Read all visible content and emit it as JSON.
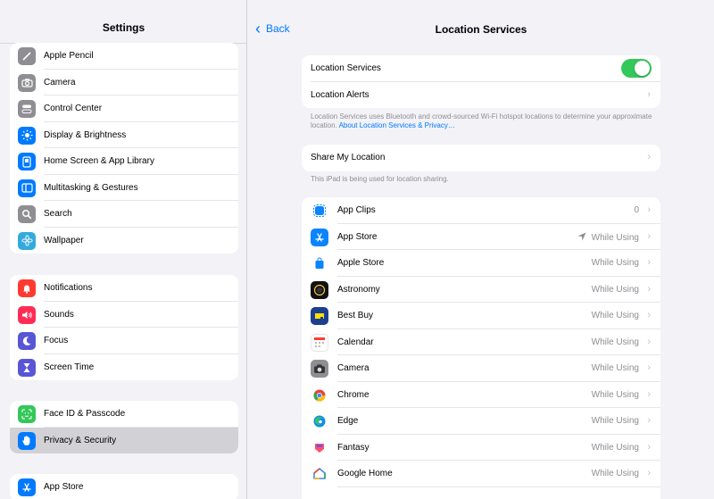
{
  "sidebar": {
    "title": "Settings",
    "group1": [
      {
        "label": "Apple Pencil",
        "icon": "pencil-icon",
        "color": "#8e8e93"
      },
      {
        "label": "Camera",
        "icon": "camera-icon",
        "color": "#8e8e93"
      },
      {
        "label": "Control Center",
        "icon": "toggles-icon",
        "color": "#8e8e93"
      },
      {
        "label": "Display & Brightness",
        "icon": "sun-icon",
        "color": "#007aff"
      },
      {
        "label": "Home Screen & App Library",
        "icon": "home-screen-icon",
        "color": "#007aff"
      },
      {
        "label": "Multitasking & Gestures",
        "icon": "multitasking-icon",
        "color": "#007aff"
      },
      {
        "label": "Search",
        "icon": "magnifier-icon",
        "color": "#8e8e93"
      },
      {
        "label": "Wallpaper",
        "icon": "flower-icon",
        "color": "#34aadc"
      }
    ],
    "group2": [
      {
        "label": "Notifications",
        "icon": "bell-icon",
        "color": "#ff3b30"
      },
      {
        "label": "Sounds",
        "icon": "speaker-icon",
        "color": "#ff2d55"
      },
      {
        "label": "Focus",
        "icon": "moon-icon",
        "color": "#5856d6"
      },
      {
        "label": "Screen Time",
        "icon": "hourglass-icon",
        "color": "#5856d6"
      }
    ],
    "group3": [
      {
        "label": "Face ID & Passcode",
        "icon": "face-id-icon",
        "color": "#34c759"
      },
      {
        "label": "Privacy & Security",
        "icon": "hand-icon",
        "color": "#007aff"
      }
    ],
    "group4": [
      {
        "label": "App Store",
        "icon": "app-store-icon",
        "color": "#007aff"
      }
    ]
  },
  "detail": {
    "back_label": "Back",
    "title": "Location Services",
    "location_services_label": "Location Services",
    "location_services_on": true,
    "location_alerts_label": "Location Alerts",
    "note1_text": "Location Services uses Bluetooth and crowd-sourced Wi-Fi hotspot locations to determine your approximate location.",
    "note1_link": "About Location Services & Privacy…",
    "share_label": "Share My Location",
    "note2_text": "This iPad is being used for location sharing.",
    "apps": [
      {
        "name": "App Clips",
        "value": "0",
        "icon": "app-clips-icon",
        "color": "#ffffff"
      },
      {
        "name": "App Store",
        "value": "While Using",
        "icon": "app-store-icon",
        "color": "#0a84ff",
        "arrow": true
      },
      {
        "name": "Apple Store",
        "value": "While Using",
        "icon": "apple-store-bag-icon",
        "color": "#ffffff"
      },
      {
        "name": "Astronomy",
        "value": "While Using",
        "icon": "astronomy-icon",
        "color": "#111111"
      },
      {
        "name": "Best Buy",
        "value": "While Using",
        "icon": "best-buy-icon",
        "color": "#1d3f8f"
      },
      {
        "name": "Calendar",
        "value": "While Using",
        "icon": "calendar-icon",
        "color": "#ffffff"
      },
      {
        "name": "Camera",
        "value": "While Using",
        "icon": "camera-icon",
        "color": "#8e8e93"
      },
      {
        "name": "Chrome",
        "value": "While Using",
        "icon": "chrome-icon",
        "color": "#ffffff"
      },
      {
        "name": "Edge",
        "value": "While Using",
        "icon": "edge-icon",
        "color": "#ffffff"
      },
      {
        "name": "Fantasy",
        "value": "While Using",
        "icon": "fantasy-icon",
        "color": "#ffffff"
      },
      {
        "name": "Google Home",
        "value": "While Using",
        "icon": "google-home-icon",
        "color": "#ffffff"
      }
    ]
  }
}
